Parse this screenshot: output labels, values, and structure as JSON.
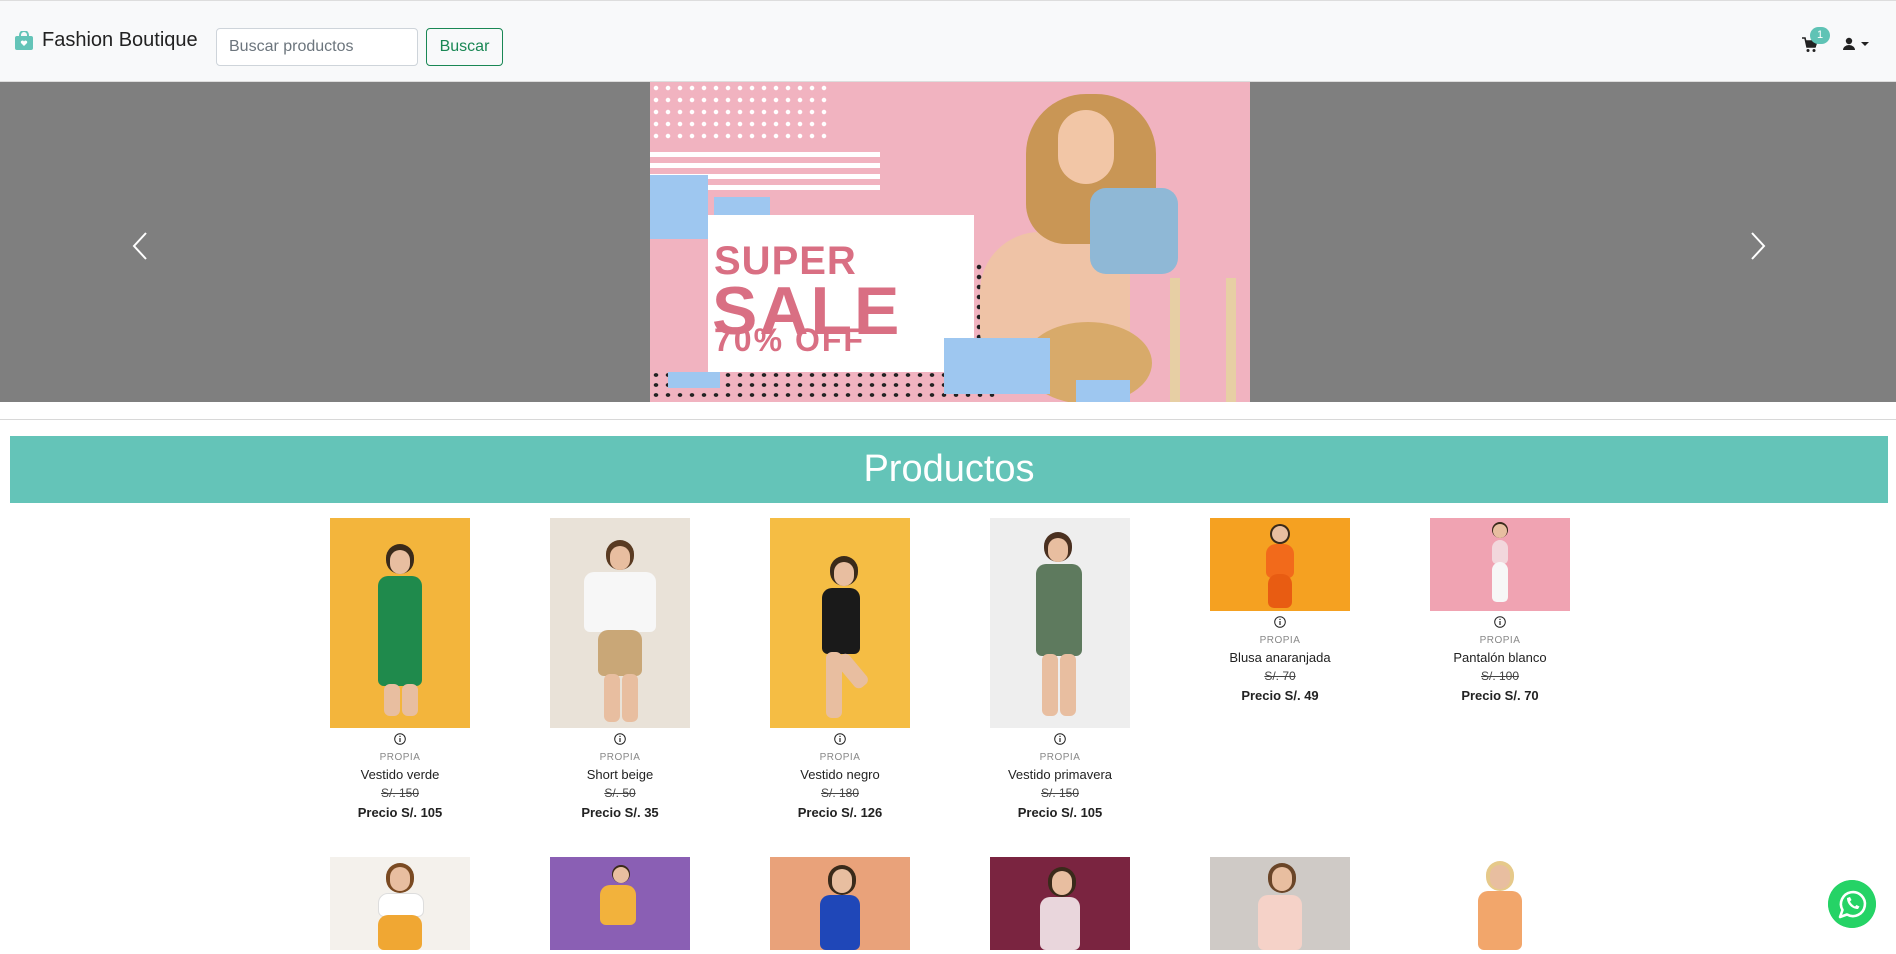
{
  "header": {
    "brand": "Fashion Boutique",
    "search_placeholder": "Buscar productos",
    "search_button": "Buscar",
    "cart_count": "1",
    "accent_color": "#64c4b8"
  },
  "carousel": {
    "banner_text": [
      "SUPER",
      "SALE",
      "70% OFF"
    ],
    "prev_icon": "chevron-left-icon",
    "next_icon": "chevron-right-icon"
  },
  "products_section": {
    "title": "Productos",
    "rows": [
      [
        {
          "brand": "PROPIA",
          "name": "Vestido verde",
          "old_price": "S/. 150",
          "price": "Precio S/. 105"
        },
        {
          "brand": "PROPIA",
          "name": "Short beige",
          "old_price": "S/. 50",
          "price": "Precio S/. 35"
        },
        {
          "brand": "PROPIA",
          "name": "Vestido negro",
          "old_price": "S/. 180",
          "price": "Precio S/. 126"
        },
        {
          "brand": "PROPIA",
          "name": "Vestido primavera",
          "old_price": "S/. 150",
          "price": "Precio S/. 105"
        },
        {
          "brand": "PROPIA",
          "name": "Blusa anaranjada",
          "old_price": "S/. 70",
          "price": "Precio S/. 49"
        },
        {
          "brand": "PROPIA",
          "name": "Pantalón blanco",
          "old_price": "S/. 100",
          "price": "Precio S/. 70"
        }
      ]
    ]
  }
}
